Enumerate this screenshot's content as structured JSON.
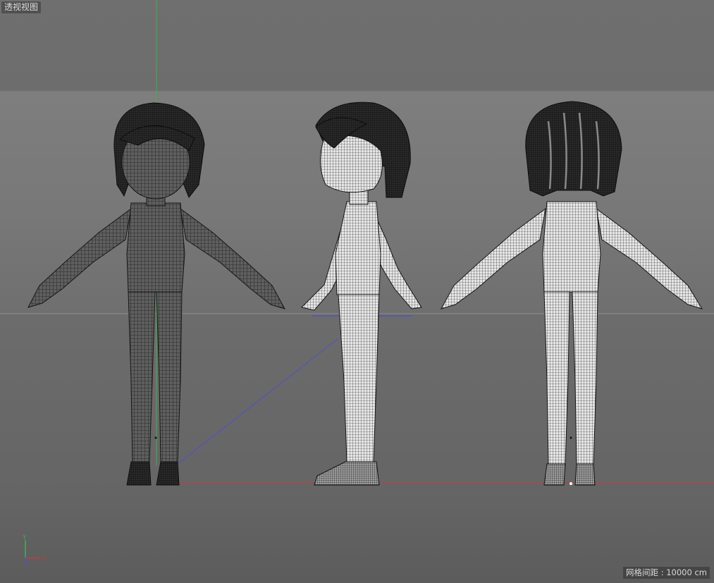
{
  "viewport": {
    "label": "透视视图",
    "grid_spacing_label": "网格间距 : 10000 cm"
  },
  "gizmo": {
    "y": "Y",
    "x": "X",
    "z": "Z"
  },
  "colors": {
    "x_axis": "#c43a3a",
    "y_axis": "#3fb04a",
    "z_axis": "#5050c8",
    "wire_dark": "#161616",
    "skin_front": "#6e6e6e",
    "skin_side": "#d6d6d6"
  },
  "scene_objects": [
    "character-front-view",
    "character-side-view",
    "character-back-view"
  ]
}
